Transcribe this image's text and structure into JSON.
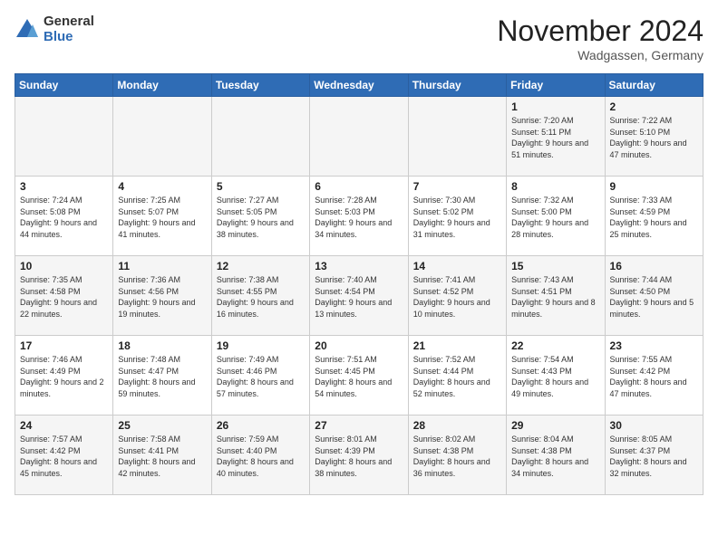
{
  "header": {
    "logo_general": "General",
    "logo_blue": "Blue",
    "month_title": "November 2024",
    "location": "Wadgassen, Germany"
  },
  "days_of_week": [
    "Sunday",
    "Monday",
    "Tuesday",
    "Wednesday",
    "Thursday",
    "Friday",
    "Saturday"
  ],
  "weeks": [
    [
      {
        "day": "",
        "info": ""
      },
      {
        "day": "",
        "info": ""
      },
      {
        "day": "",
        "info": ""
      },
      {
        "day": "",
        "info": ""
      },
      {
        "day": "",
        "info": ""
      },
      {
        "day": "1",
        "info": "Sunrise: 7:20 AM\nSunset: 5:11 PM\nDaylight: 9 hours and 51 minutes."
      },
      {
        "day": "2",
        "info": "Sunrise: 7:22 AM\nSunset: 5:10 PM\nDaylight: 9 hours and 47 minutes."
      }
    ],
    [
      {
        "day": "3",
        "info": "Sunrise: 7:24 AM\nSunset: 5:08 PM\nDaylight: 9 hours and 44 minutes."
      },
      {
        "day": "4",
        "info": "Sunrise: 7:25 AM\nSunset: 5:07 PM\nDaylight: 9 hours and 41 minutes."
      },
      {
        "day": "5",
        "info": "Sunrise: 7:27 AM\nSunset: 5:05 PM\nDaylight: 9 hours and 38 minutes."
      },
      {
        "day": "6",
        "info": "Sunrise: 7:28 AM\nSunset: 5:03 PM\nDaylight: 9 hours and 34 minutes."
      },
      {
        "day": "7",
        "info": "Sunrise: 7:30 AM\nSunset: 5:02 PM\nDaylight: 9 hours and 31 minutes."
      },
      {
        "day": "8",
        "info": "Sunrise: 7:32 AM\nSunset: 5:00 PM\nDaylight: 9 hours and 28 minutes."
      },
      {
        "day": "9",
        "info": "Sunrise: 7:33 AM\nSunset: 4:59 PM\nDaylight: 9 hours and 25 minutes."
      }
    ],
    [
      {
        "day": "10",
        "info": "Sunrise: 7:35 AM\nSunset: 4:58 PM\nDaylight: 9 hours and 22 minutes."
      },
      {
        "day": "11",
        "info": "Sunrise: 7:36 AM\nSunset: 4:56 PM\nDaylight: 9 hours and 19 minutes."
      },
      {
        "day": "12",
        "info": "Sunrise: 7:38 AM\nSunset: 4:55 PM\nDaylight: 9 hours and 16 minutes."
      },
      {
        "day": "13",
        "info": "Sunrise: 7:40 AM\nSunset: 4:54 PM\nDaylight: 9 hours and 13 minutes."
      },
      {
        "day": "14",
        "info": "Sunrise: 7:41 AM\nSunset: 4:52 PM\nDaylight: 9 hours and 10 minutes."
      },
      {
        "day": "15",
        "info": "Sunrise: 7:43 AM\nSunset: 4:51 PM\nDaylight: 9 hours and 8 minutes."
      },
      {
        "day": "16",
        "info": "Sunrise: 7:44 AM\nSunset: 4:50 PM\nDaylight: 9 hours and 5 minutes."
      }
    ],
    [
      {
        "day": "17",
        "info": "Sunrise: 7:46 AM\nSunset: 4:49 PM\nDaylight: 9 hours and 2 minutes."
      },
      {
        "day": "18",
        "info": "Sunrise: 7:48 AM\nSunset: 4:47 PM\nDaylight: 8 hours and 59 minutes."
      },
      {
        "day": "19",
        "info": "Sunrise: 7:49 AM\nSunset: 4:46 PM\nDaylight: 8 hours and 57 minutes."
      },
      {
        "day": "20",
        "info": "Sunrise: 7:51 AM\nSunset: 4:45 PM\nDaylight: 8 hours and 54 minutes."
      },
      {
        "day": "21",
        "info": "Sunrise: 7:52 AM\nSunset: 4:44 PM\nDaylight: 8 hours and 52 minutes."
      },
      {
        "day": "22",
        "info": "Sunrise: 7:54 AM\nSunset: 4:43 PM\nDaylight: 8 hours and 49 minutes."
      },
      {
        "day": "23",
        "info": "Sunrise: 7:55 AM\nSunset: 4:42 PM\nDaylight: 8 hours and 47 minutes."
      }
    ],
    [
      {
        "day": "24",
        "info": "Sunrise: 7:57 AM\nSunset: 4:42 PM\nDaylight: 8 hours and 45 minutes."
      },
      {
        "day": "25",
        "info": "Sunrise: 7:58 AM\nSunset: 4:41 PM\nDaylight: 8 hours and 42 minutes."
      },
      {
        "day": "26",
        "info": "Sunrise: 7:59 AM\nSunset: 4:40 PM\nDaylight: 8 hours and 40 minutes."
      },
      {
        "day": "27",
        "info": "Sunrise: 8:01 AM\nSunset: 4:39 PM\nDaylight: 8 hours and 38 minutes."
      },
      {
        "day": "28",
        "info": "Sunrise: 8:02 AM\nSunset: 4:38 PM\nDaylight: 8 hours and 36 minutes."
      },
      {
        "day": "29",
        "info": "Sunrise: 8:04 AM\nSunset: 4:38 PM\nDaylight: 8 hours and 34 minutes."
      },
      {
        "day": "30",
        "info": "Sunrise: 8:05 AM\nSunset: 4:37 PM\nDaylight: 8 hours and 32 minutes."
      }
    ]
  ]
}
